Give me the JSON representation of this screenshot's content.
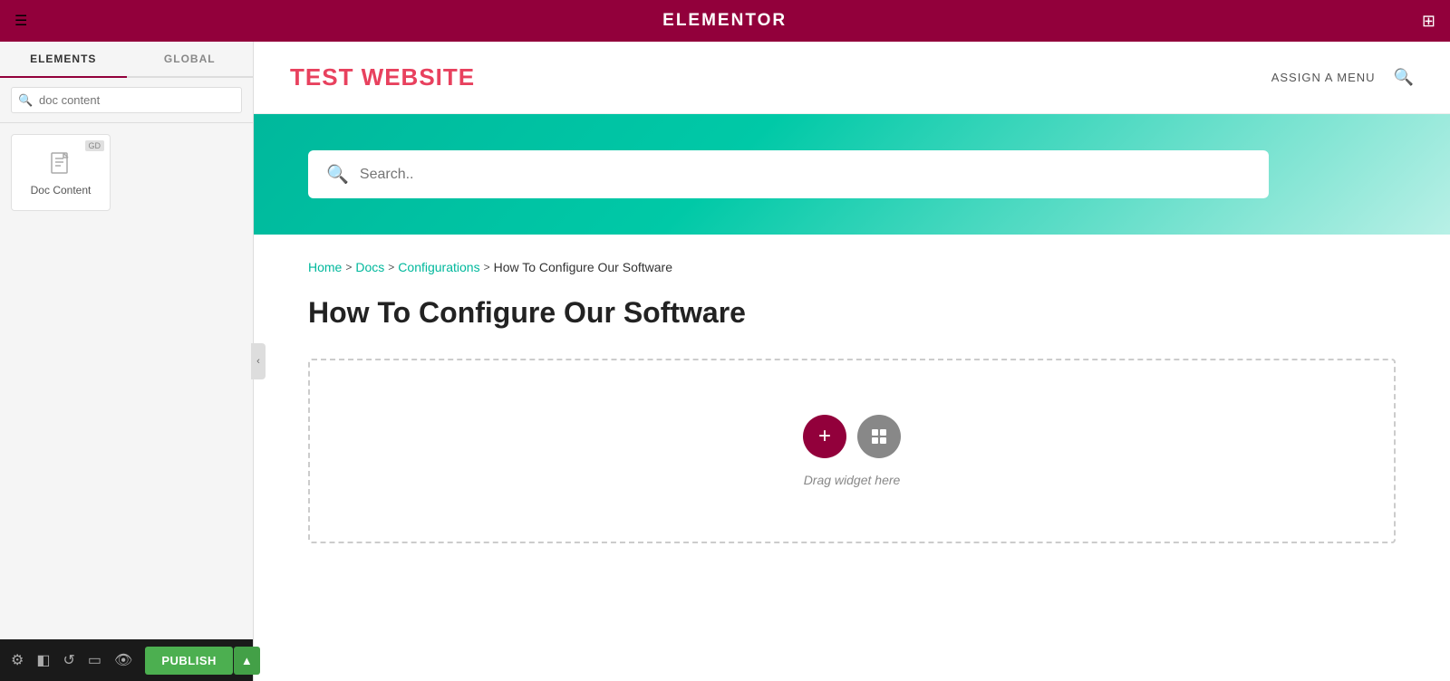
{
  "topbar": {
    "logo": "elementor",
    "hamburger_icon": "☰",
    "grid_icon": "⊞"
  },
  "sidebar": {
    "tabs": [
      {
        "id": "elements",
        "label": "ELEMENTS",
        "active": true
      },
      {
        "id": "global",
        "label": "GLOBAL",
        "active": false
      }
    ],
    "search_placeholder": "doc content",
    "widgets": [
      {
        "id": "doc-content",
        "label": "Doc Content",
        "badge": "GD"
      }
    ]
  },
  "bottom_toolbar": {
    "icons": [
      "gear",
      "layers",
      "history",
      "responsive",
      "eye"
    ],
    "publish_label": "PUBLISH",
    "arrow_label": "▲"
  },
  "site_header": {
    "title": "TEST WEBSITE",
    "nav": {
      "assign_menu": "ASSIGN A MENU",
      "search_icon": "🔍"
    }
  },
  "hero": {
    "search_placeholder": "Search.."
  },
  "breadcrumb": {
    "items": [
      {
        "label": "Home",
        "link": true
      },
      {
        "label": ">",
        "sep": true
      },
      {
        "label": "Docs",
        "link": true
      },
      {
        "label": ">",
        "sep": true
      },
      {
        "label": "Configurations",
        "link": true
      },
      {
        "label": ">",
        "sep": true
      },
      {
        "label": "How To Configure Our Software",
        "link": false
      }
    ]
  },
  "page": {
    "title": "How To Configure Our Software"
  },
  "drop_zone": {
    "drag_label": "Drag widget here"
  }
}
